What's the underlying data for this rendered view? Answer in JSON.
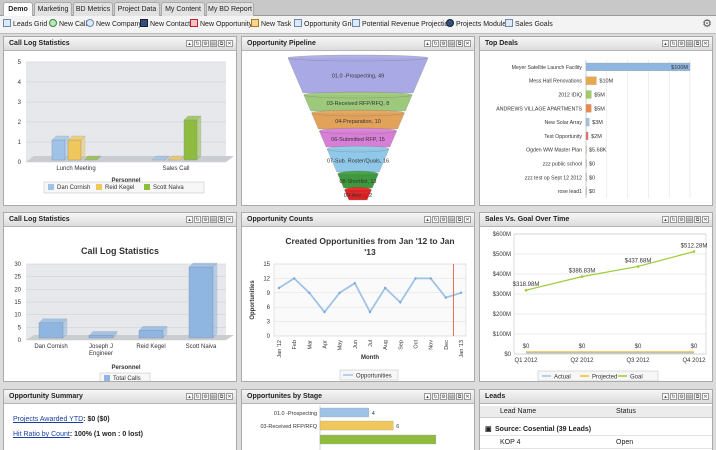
{
  "tabs": [
    "Demo",
    "Marketing",
    "BD Metrics",
    "Project Data",
    "My Content",
    "My BD Report"
  ],
  "toolbar": [
    "Leads Grid",
    "New Call",
    "New Company",
    "New Contact",
    "New Opportunity",
    "New Task",
    "Opportunity Grid",
    "Potential Revenue Projection",
    "Projects Module",
    "Sales Goals"
  ],
  "icons": [
    "grid-icon",
    "phone-icon",
    "company-icon",
    "contact-icon",
    "briefcase-icon",
    "task-icon",
    "grid-icon",
    "projection-icon",
    "module-icon",
    "goal-icon",
    "gear-icon"
  ],
  "panels": {
    "p1": {
      "title": "Call Log Statistics"
    },
    "p2": {
      "title": "Opportunity Pipeline"
    },
    "p3": {
      "title": "Top Deals"
    },
    "p4": {
      "title": "Call Log Statistics"
    },
    "p5": {
      "title": "Opportunity Counts"
    },
    "p6": {
      "title": "Sales Vs. Goal Over Time"
    },
    "p7": {
      "title": "Opportunity Summary"
    },
    "p8": {
      "title": "Opportunites by Stage"
    },
    "p9": {
      "title": "Leads"
    }
  },
  "summary": {
    "row1_link": "Projects Awarded YTD",
    "row1_value": ": $0 ($0)",
    "row2_link": "Hit Ratio by Count",
    "row2_value": ": 100% (1 won : 0 lost)"
  },
  "leads": {
    "col1": "Lead Name",
    "col2": "Status",
    "group": "Source: Cosential (39 Leads)",
    "row_name": "KOP 4",
    "row_status": "Open"
  },
  "colors": {
    "accent": "#7aa7d8",
    "bg": "#dcdcdc"
  },
  "chart_data": [
    {
      "type": "bar",
      "title": "",
      "categories": [
        "Lunch Meeting",
        "Sales Call"
      ],
      "xlabel": "Personnel",
      "ylim": [
        0,
        5
      ],
      "yticks": [
        0,
        1,
        2,
        3,
        4,
        5
      ],
      "series": [
        {
          "name": "Dan Cornish",
          "color": "#9fc3e6",
          "values": [
            1,
            0
          ]
        },
        {
          "name": "Reid Kegel",
          "color": "#f0c75a",
          "values": [
            1,
            0
          ]
        },
        {
          "name": "Scott Naiva",
          "color": "#8fbc3e",
          "values": [
            0,
            2
          ]
        }
      ],
      "legend": "bottom"
    },
    {
      "type": "funnel",
      "stages": [
        {
          "label": "01.0 -Prospecting, 49",
          "value": 49,
          "color": "#a9a9e6"
        },
        {
          "label": "03-Received RFP/RFQ, 8",
          "value": 8,
          "color": "#9dc97a"
        },
        {
          "label": "04-Preparation, 10",
          "value": 10,
          "color": "#e2a25a"
        },
        {
          "label": "06-Submitted RFP, 15",
          "value": 15,
          "color": "#d77fd6"
        },
        {
          "label": "07-Sub. Roster/Quals, 16",
          "value": 16,
          "color": "#8fc8e8"
        },
        {
          "label": "08-Shortlist, 13",
          "value": 13,
          "color": "#3c9a3c"
        },
        {
          "label": "09-Ann..., 2",
          "value": 2,
          "color": "#e02020"
        }
      ]
    },
    {
      "type": "bar",
      "orientation": "horizontal",
      "xticks": [
        "$0",
        "$20M",
        "$40M",
        "$60M",
        "$80M",
        "$100M"
      ],
      "xlim": [
        0,
        100
      ],
      "categories": [
        "Meyer Satellite Launch Facility",
        "Mess Hall Renovations",
        "2012 IDIQ",
        "ANDREWS VILLAGE APARTMENTS",
        "New Solar Array",
        "Test Opportunity",
        "Ogden WW Master Plan",
        "zzz public school",
        "zzz test op Sept 12 2012",
        "rose lead1"
      ],
      "values": [
        100,
        10,
        5,
        5,
        3,
        2,
        0.00568,
        0,
        0,
        0
      ],
      "labels": [
        "$100M",
        "$10M",
        "$5M",
        "$5M",
        "$3M",
        "$2M",
        "$5.68K",
        "$0",
        "$0",
        "$0"
      ],
      "colors": [
        "#8fb6e0",
        "#e7a94a",
        "#9fcf5a",
        "#e98a4a",
        "#9fc3e6",
        "#e07070",
        "#d6c95a",
        "#aaaaaa",
        "#aaaaaa",
        "#aaaaaa"
      ]
    },
    {
      "type": "bar",
      "title": "Call Log Statistics",
      "categories": [
        "Dan Cornish",
        "Joseph J Engineer",
        "Reid Kegel",
        "Scott Naiva"
      ],
      "xlabel": "Personnel",
      "ylim": [
        0,
        30
      ],
      "yticks": [
        0,
        5,
        10,
        15,
        20,
        25,
        30
      ],
      "series": [
        {
          "name": "Total Calls",
          "color": "#8fb6e0",
          "values": [
            6,
            1,
            3,
            28
          ]
        }
      ],
      "legend": "bottom"
    },
    {
      "type": "line",
      "title": "Created Opportunities from Jan '12 to Jan '13",
      "xlabel": "Month",
      "ylabel": "Opportunities",
      "ylim": [
        0,
        15
      ],
      "yticks": [
        0,
        3,
        6,
        9,
        12,
        15
      ],
      "x": [
        "Jan '12",
        "Feb",
        "Mar",
        "Apr",
        "May",
        "Jun",
        "Jul",
        "Aug",
        "Sep",
        "Oct",
        "Nov",
        "Dec",
        "Jan '13"
      ],
      "series": [
        {
          "name": "Opportunities",
          "color": "#9fc3e6",
          "values": [
            10,
            12,
            9,
            5,
            9,
            11,
            5,
            10,
            7,
            12,
            12,
            8,
            9
          ]
        }
      ],
      "legend": "bottom"
    },
    {
      "type": "line",
      "ylim": [
        0,
        600
      ],
      "yticks": [
        "$0",
        "$100M",
        "$200M",
        "$300M",
        "$400M",
        "$500M",
        "$600M"
      ],
      "x": [
        "Q1 2012",
        "Q2 2012",
        "Q3 2012",
        "Q4 2012"
      ],
      "series": [
        {
          "name": "Actual",
          "color": "#9fc3e6",
          "values": [
            0,
            0,
            0,
            0
          ],
          "labels": [
            "$0",
            "$0",
            "$0",
            "$0"
          ]
        },
        {
          "name": "Projected",
          "color": "#f0c030",
          "values": [
            0,
            0,
            0,
            0
          ]
        },
        {
          "name": "Goal",
          "color": "#9acd32",
          "values": [
            318.98,
            386.83,
            437.68,
            512.28
          ],
          "labels": [
            "$318.98M",
            "$386.83M",
            "$437.68M",
            "$512.28M"
          ]
        }
      ],
      "legend": "bottom"
    },
    {
      "type": "bar",
      "orientation": "horizontal",
      "categories": [
        "01.0 -Prospecting",
        "03-Received RFP/RFQ"
      ],
      "values": [
        4,
        6
      ],
      "colors": [
        "#9fc3e6",
        "#f0c75a"
      ],
      "xlim": [
        0,
        10
      ]
    }
  ]
}
